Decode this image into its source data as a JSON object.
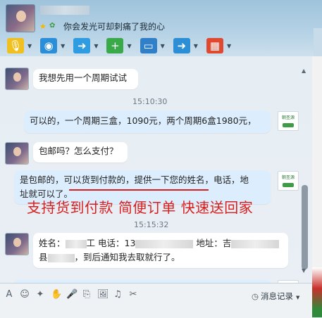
{
  "header": {
    "status_text": "你会发光可却刺痛了我的心",
    "status_icon": "★"
  },
  "toolbar": {
    "items": [
      {
        "name": "microphone-icon",
        "glyph": "🎙",
        "color": "#f0c020"
      },
      {
        "name": "video-call-icon",
        "glyph": "◉",
        "color": "#2a8fd8"
      },
      {
        "name": "file-transfer-icon",
        "glyph": "➜",
        "color": "#2f9be0"
      },
      {
        "name": "add-message-icon",
        "glyph": "+",
        "color": "#3aa94a"
      },
      {
        "name": "remote-desktop-icon",
        "glyph": "▭",
        "color": "#2f7fc9"
      },
      {
        "name": "screen-share-icon",
        "glyph": "➜",
        "color": "#2c8fd5"
      },
      {
        "name": "apps-icon",
        "glyph": "▦",
        "color": "#e0492f"
      }
    ]
  },
  "messages": [
    {
      "side": "left",
      "text": "我想先用一个周期试试"
    },
    {
      "side": "time",
      "text": "15:10:30"
    },
    {
      "side": "right",
      "text": "可以的，一个周期三盒，1090元，两个周期6盒1980元，"
    },
    {
      "side": "left",
      "text": "包邮吗？怎么支付？"
    },
    {
      "side": "right",
      "line1": "是包邮的，可以货到付款的，提供一下您的姓名，电话，地",
      "line2": "址就可以了。"
    },
    {
      "side": "time",
      "text": "15:15:32"
    },
    {
      "side": "left",
      "line1a": "姓名：",
      "line1b": "工 电话：13",
      "line1c": "地址：吉",
      "line2a": "县",
      "line2b": "，到后通知我去取就行了。"
    }
  ],
  "brand_badge": "朝圣源",
  "overlay_text": "支持货到付款 简便订单 快速送回家",
  "input_toolbar": {
    "icons": [
      "A",
      "☺",
      "✦",
      "✋",
      "🎤",
      "⎘",
      "🖼",
      "♫",
      "✂"
    ],
    "history_label": "消息记录",
    "history_icon": "◷"
  }
}
